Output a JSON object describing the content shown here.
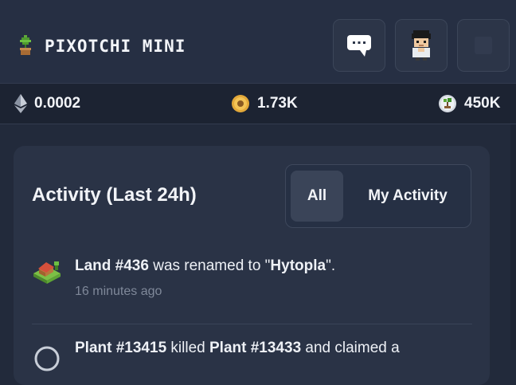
{
  "header": {
    "title": "PIXOTCHI MINI",
    "logo_icon": "potted-plant-icon",
    "buttons": [
      {
        "name": "chat",
        "icon": "chat-bubble-icon"
      },
      {
        "name": "profile",
        "icon": "pixel-avatar-icon"
      },
      {
        "name": "menu",
        "icon": "empty-square-icon"
      }
    ]
  },
  "stats": {
    "eth": {
      "icon": "ethereum-icon",
      "value": "0.0002"
    },
    "seed": {
      "icon": "seed-token-icon",
      "value": "1.73K"
    },
    "leaf": {
      "icon": "leaf-token-icon",
      "value": "450K"
    }
  },
  "activity": {
    "title": "Activity (Last 24h)",
    "filters": {
      "all": "All",
      "mine": "My Activity",
      "selected": "All"
    },
    "items": [
      {
        "icon": "land-plot-icon",
        "parts": [
          "Land #436",
          " was renamed to \"",
          "Hytopla",
          "\"."
        ],
        "time": "16 minutes ago"
      },
      {
        "icon": "plant-icon",
        "parts": [
          "Plant #13415",
          " killed ",
          "Plant #13433",
          " and claimed a"
        ]
      }
    ]
  },
  "colors": {
    "background": "#222a3b",
    "card": "#2a3346",
    "statsbar": "#1c2332",
    "text": "#f2f4f8",
    "muted": "#7f8899"
  }
}
